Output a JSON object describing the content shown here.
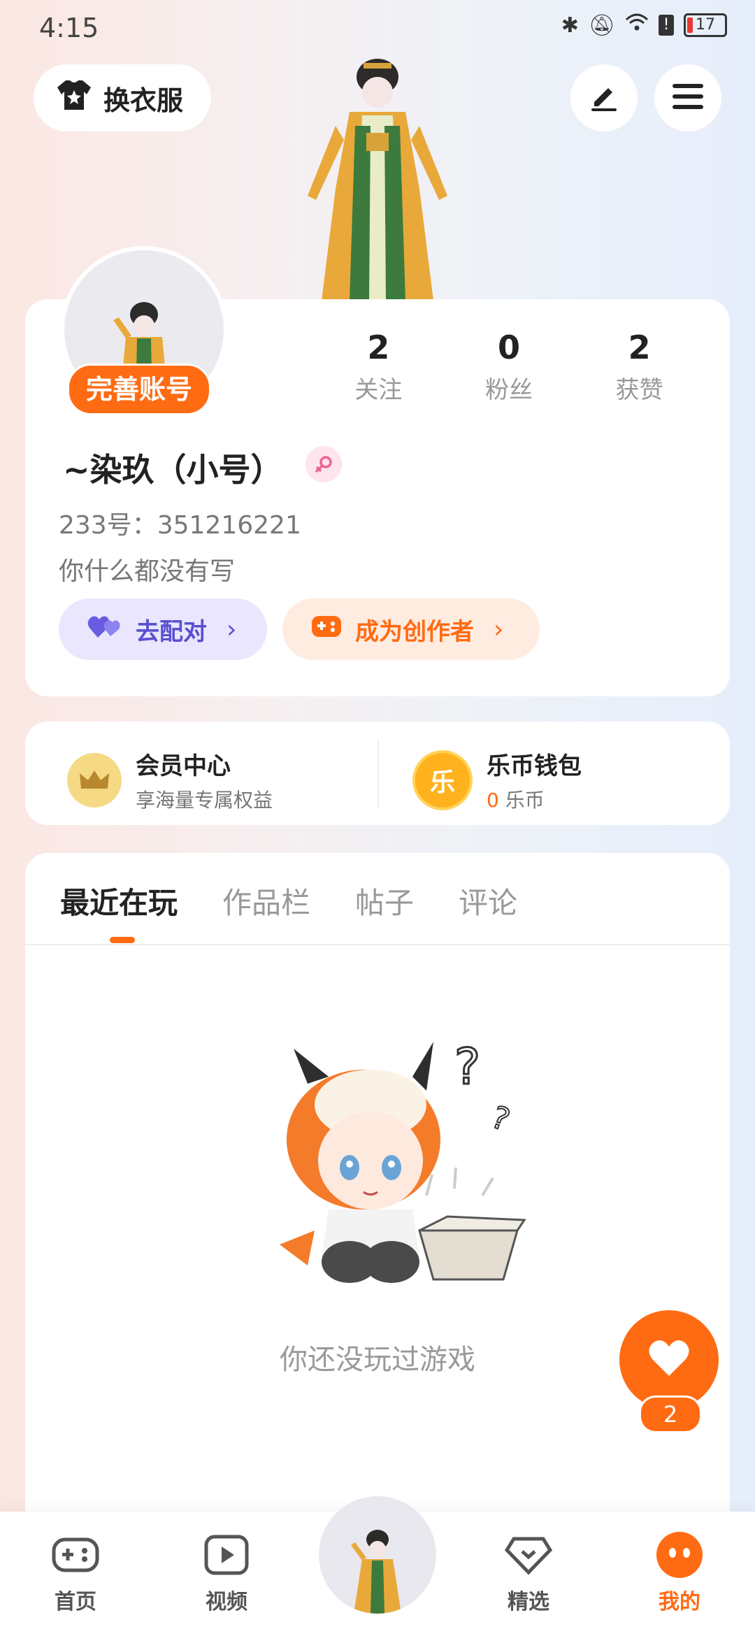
{
  "status_bar": {
    "time": "4:15",
    "battery": "17"
  },
  "header": {
    "outfit_label": "换衣服"
  },
  "profile": {
    "complete_label": "完善账号",
    "stats": [
      {
        "value": "2",
        "label": "关注"
      },
      {
        "value": "0",
        "label": "粉丝"
      },
      {
        "value": "2",
        "label": "获赞"
      }
    ],
    "nickname": "~染玖（小号）",
    "uid": "233号：351216221",
    "bio": "你什么都没有写",
    "pair_label": "去配对",
    "creator_label": "成为创作者"
  },
  "member": {
    "vip_title": "会员中心",
    "vip_sub": "享海量专属权益",
    "wallet_title": "乐币钱包",
    "wallet_amount": "0",
    "wallet_unit": "乐币",
    "coin_char": "乐"
  },
  "tabs": [
    "最近在玩",
    "作品栏",
    "帖子",
    "评论"
  ],
  "empty_text": "你还没玩过游戏",
  "fab_count": "2",
  "bottom_nav": [
    {
      "label": "首页"
    },
    {
      "label": "视频"
    },
    {
      "label": "精选"
    },
    {
      "label": "我的"
    }
  ],
  "colors": {
    "accent": "#ff6b12",
    "pair": "#5a4fd0"
  }
}
